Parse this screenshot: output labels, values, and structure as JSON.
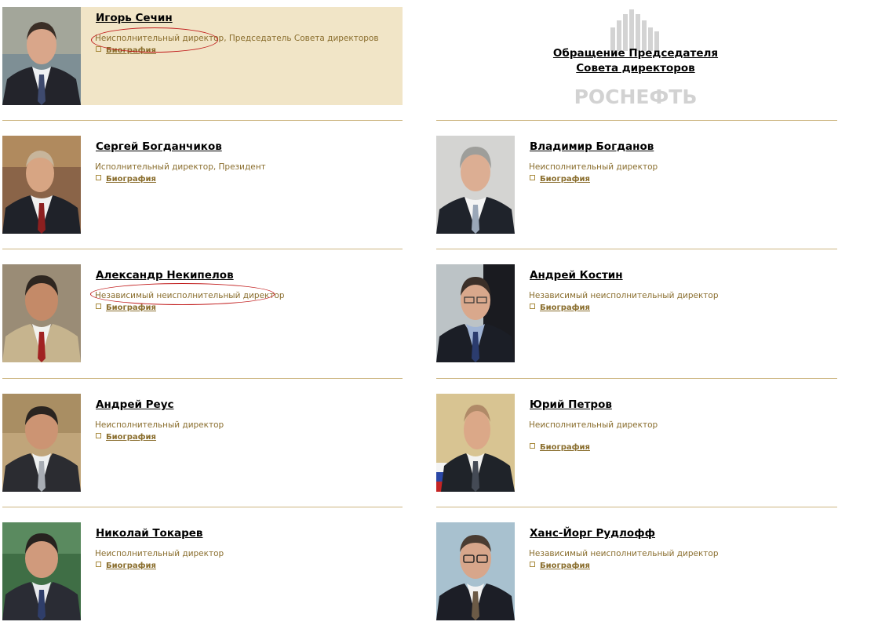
{
  "appeal": {
    "line1": "Обращение Председателя",
    "line2": "Совета директоров",
    "logo_text": "РОСНЕФТЬ"
  },
  "bio_label": "Биография",
  "colors": {
    "highlight_bg": "#f1e5c7",
    "role_text": "#8a6e2e",
    "rule": "#ccb47f",
    "circle": "#c01818"
  },
  "directors": [
    {
      "name": "Игорь Сечин",
      "role": "Неисполнительный директор, Председатель Совета директоров",
      "highlighted": true
    },
    {
      "name": "Сергей Богданчиков",
      "role": "Исполнительный директор, Президент"
    },
    {
      "name": "Владимир Богданов",
      "role": "Неисполнительный директор"
    },
    {
      "name": "Александр Некипелов",
      "role": "Независимый неисполнительный директор"
    },
    {
      "name": "Андрей Костин",
      "role": "Независимый неисполнительный директор"
    },
    {
      "name": "Андрей Реус",
      "role": "Неисполнительный директор"
    },
    {
      "name": "Юрий Петров",
      "role": "Неисполнительный директор"
    },
    {
      "name": "Николай Токарев",
      "role": "Неисполнительный директор"
    },
    {
      "name": "Ханс-Йорг Рудлофф",
      "role": "Независимый неисполнительный директор"
    }
  ]
}
